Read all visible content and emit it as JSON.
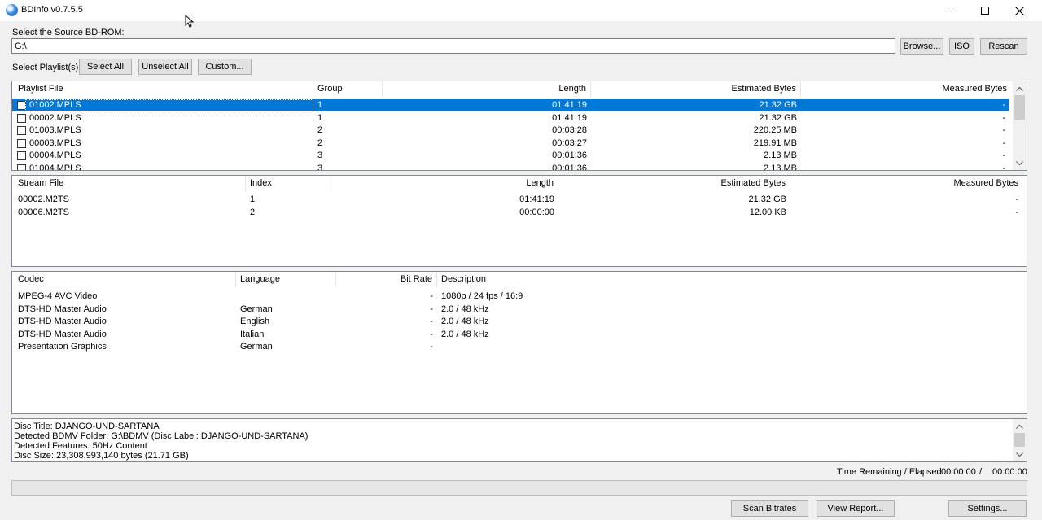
{
  "window": {
    "title": "BDInfo v0.7.5.5"
  },
  "source": {
    "label": "Select the Source BD-ROM:",
    "path": "G:\\",
    "browse": "Browse...",
    "iso": "ISO",
    "rescan": "Rescan"
  },
  "playlist_controls": {
    "label": "Select Playlist(s):",
    "select_all": "Select All",
    "unselect_all": "Unselect All",
    "custom": "Custom..."
  },
  "playlists": {
    "headers": [
      "Playlist File",
      "Group",
      "Length",
      "Estimated Bytes",
      "Measured Bytes"
    ],
    "rows": [
      {
        "file": "01002.MPLS",
        "group": "1",
        "length": "01:41:19",
        "est": "21.32 GB",
        "measured": "-"
      },
      {
        "file": "00002.MPLS",
        "group": "1",
        "length": "01:41:19",
        "est": "21.32 GB",
        "measured": "-"
      },
      {
        "file": "01003.MPLS",
        "group": "2",
        "length": "00:03:28",
        "est": "220.25 MB",
        "measured": "-"
      },
      {
        "file": "00003.MPLS",
        "group": "2",
        "length": "00:03:27",
        "est": "219.91 MB",
        "measured": "-"
      },
      {
        "file": "00004.MPLS",
        "group": "3",
        "length": "00:01:36",
        "est": "2.13 MB",
        "measured": "-"
      },
      {
        "file": "01004.MPLS",
        "group": "3",
        "length": "00:01:36",
        "est": "2.13 MB",
        "measured": "-"
      }
    ]
  },
  "streams": {
    "headers": [
      "Stream File",
      "Index",
      "Length",
      "Estimated Bytes",
      "Measured Bytes"
    ],
    "rows": [
      {
        "file": "00002.M2TS",
        "index": "1",
        "length": "01:41:19",
        "est": "21.32 GB",
        "measured": "-"
      },
      {
        "file": "00006.M2TS",
        "index": "2",
        "length": "00:00:00",
        "est": "12.00 KB",
        "measured": "-"
      }
    ]
  },
  "codecs": {
    "headers": [
      "Codec",
      "Language",
      "Bit Rate",
      "Description"
    ],
    "rows": [
      {
        "codec": "MPEG-4 AVC Video",
        "language": "",
        "bitrate": "-",
        "desc": "1080p / 24 fps / 16:9"
      },
      {
        "codec": "DTS-HD Master Audio",
        "language": "German",
        "bitrate": "-",
        "desc": "2.0 / 48 kHz"
      },
      {
        "codec": "DTS-HD Master Audio",
        "language": "English",
        "bitrate": "-",
        "desc": "2.0 / 48 kHz"
      },
      {
        "codec": "DTS-HD Master Audio",
        "language": "Italian",
        "bitrate": "-",
        "desc": "2.0 / 48 kHz"
      },
      {
        "codec": "Presentation Graphics",
        "language": "German",
        "bitrate": "-",
        "desc": ""
      }
    ]
  },
  "disc_info": [
    "Disc Title: DJANGO-UND-SARTANA",
    "Detected BDMV Folder: G:\\BDMV (Disc Label: DJANGO-UND-SARTANA)",
    "Detected Features: 50Hz Content",
    "Disc Size: 23,308,993,140 bytes (21.71 GB)"
  ],
  "status": {
    "time_label": "Time Remaining / Elapsed:",
    "remaining": "00:00:00",
    "separator": "/",
    "elapsed": "00:00:00",
    "progress": 0
  },
  "actions": {
    "scan_bitrates": "Scan Bitrates",
    "view_report": "View Report...",
    "settings": "Settings..."
  },
  "icons": {
    "app": "bdinfo-disc-icon",
    "minimize": "minimize-icon",
    "maximize": "maximize-icon",
    "close": "close-icon",
    "scroll_up": "chevron-up-icon",
    "scroll_down": "chevron-down-icon"
  }
}
